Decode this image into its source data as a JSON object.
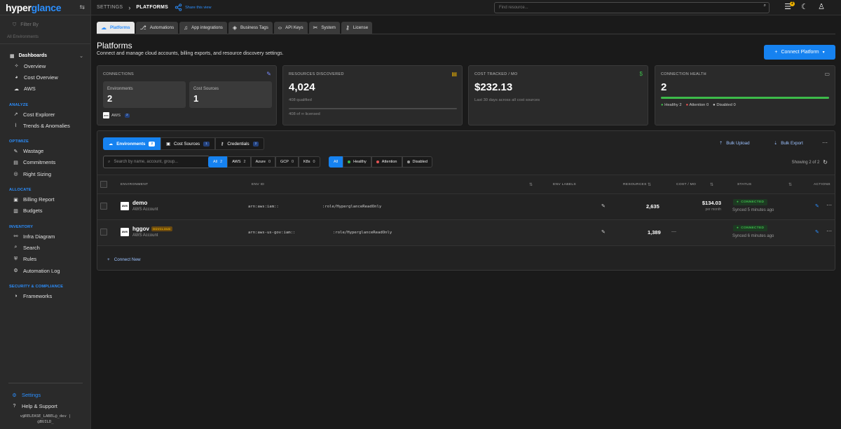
{
  "app": {
    "logo_a": "hyper",
    "logo_b": "glance"
  },
  "sidebar": {
    "filter_placeholder": "Filter By",
    "filter_scope": "All Environments",
    "dashboards": {
      "label": "Dashboards",
      "items": [
        {
          "label": "Overview",
          "icon": "sparkle-icon"
        },
        {
          "label": "Cost Overview",
          "icon": "pie-icon"
        },
        {
          "label": "AWS",
          "icon": "cloud-icon"
        }
      ]
    },
    "sections": [
      {
        "title": "ANALYZE",
        "items": [
          {
            "label": "Cost Explorer",
            "icon": "trend-icon"
          },
          {
            "label": "Trends & Anomalies",
            "icon": "chart-icon"
          }
        ]
      },
      {
        "title": "OPTIMIZE",
        "items": [
          {
            "label": "Wastage",
            "icon": "wrench-icon"
          },
          {
            "label": "Commitments",
            "icon": "calendar-icon"
          },
          {
            "label": "Right Sizing",
            "icon": "target-icon"
          }
        ]
      },
      {
        "title": "ALLOCATE",
        "items": [
          {
            "label": "Billing Report",
            "icon": "receipt-icon"
          },
          {
            "label": "Budgets",
            "icon": "wallet-icon"
          }
        ]
      },
      {
        "title": "INVENTORY",
        "items": [
          {
            "label": "Infra Diagram",
            "icon": "network-icon"
          },
          {
            "label": "Search",
            "icon": "search-icon"
          },
          {
            "label": "Rules",
            "icon": "shield-icon"
          },
          {
            "label": "Automation Log",
            "icon": "gear-icon"
          }
        ]
      },
      {
        "title": "SECURITY & COMPLIANCE",
        "items": [
          {
            "label": "Frameworks",
            "icon": "contrast-icon"
          }
        ]
      }
    ],
    "settings_label": "Settings",
    "help_label": "Help & Support",
    "version_line1": "v@RELEASE_LABEL@_dev |",
    "version_line2": "@BUILD_"
  },
  "topbar": {
    "crumb_root": "SETTINGS",
    "crumb_current": "PLATFORMS",
    "share_label": "Share this view",
    "search_placeholder": "Find resource...",
    "notif_count": "2"
  },
  "tabs": [
    {
      "label": "Platforms",
      "icon": "cloud-icon",
      "active": true
    },
    {
      "label": "Automations",
      "icon": "flow-icon"
    },
    {
      "label": "App integrations",
      "icon": "bell-icon"
    },
    {
      "label": "Business Tags",
      "icon": "tag-icon"
    },
    {
      "label": "API Keys",
      "icon": "code-icon"
    },
    {
      "label": "System",
      "icon": "wrench-icon"
    },
    {
      "label": "License",
      "icon": "key-icon"
    }
  ],
  "page": {
    "title": "Platforms",
    "subtitle": "Connect and manage cloud accounts, billing exports, and resource discovery settings.",
    "cta_label": "Connect Platform"
  },
  "cards": {
    "connections": {
      "title": "CONNECTIONS",
      "env_label": "Environments",
      "env_value": "2",
      "cost_label": "Cost Sources",
      "cost_value": "1",
      "chip_label": "AWS",
      "chip_count": "2"
    },
    "resources": {
      "title": "RESOURCES DISCOVERED",
      "value": "4,024",
      "note1": "408 qualified",
      "note2": "408 of ∞ licensed",
      "fill": 0
    },
    "cost": {
      "title": "COST TRACKED / MO",
      "value": "$232.13",
      "note": "Last 30 days across all cost sources"
    },
    "health": {
      "title": "CONNECTION HEALTH",
      "value": "2",
      "fill": 1.0,
      "healthy": "Healthy 2",
      "attention": "Attention 0",
      "disabled": "Disabled 0"
    }
  },
  "panel": {
    "subtabs": [
      {
        "label": "Environments",
        "count": "2",
        "icon": "cloud-icon",
        "active": true
      },
      {
        "label": "Cost Sources",
        "count": "1",
        "icon": "receipt-icon"
      },
      {
        "label": "Credentials",
        "count": "2",
        "icon": "key-icon"
      }
    ],
    "bulk_upload": "Bulk Upload",
    "bulk_export": "Bulk Export",
    "search_placeholder": "Search by name, account, group...",
    "provider_pills": [
      {
        "label": "All",
        "count": "2",
        "active": true
      },
      {
        "label": "AWS",
        "count": "2"
      },
      {
        "label": "Azure",
        "count": "0"
      },
      {
        "label": "GCP",
        "count": "0"
      },
      {
        "label": "K8s",
        "count": "0"
      }
    ],
    "status_pills": [
      {
        "label": "All",
        "active": true
      },
      {
        "label": "Healthy",
        "color": "#3dbb4a"
      },
      {
        "label": "Attention",
        "color": "#e55555"
      },
      {
        "label": "Disabled",
        "color": "#999999"
      }
    ],
    "showing": "Showing 2 of 2",
    "columns": {
      "environment": "ENVIRONMENT",
      "env_id": "ENV ID",
      "env_labels": "ENV LABELS",
      "resources": "RESOURCES",
      "cost": "COST / MO",
      "status": "STATUS",
      "actions": "ACTIONS"
    },
    "rows": [
      {
        "name": "demo",
        "sub": "AWS Account",
        "badge": "",
        "arn_a": "arn:aws:iam::",
        "arn_b": ":role/HyperglanceReadOnly",
        "resources": "2,635",
        "cost": "$134.03",
        "cost_sub": "per month",
        "status": "CONNECTED",
        "synced": "Synced 5 minutes ago"
      },
      {
        "name": "hggov",
        "sub": "AWS Account",
        "badge": "GOVCLOUD",
        "arn_a": "arn:aws-us-gov:iam::",
        "arn_b": ":role/HyperglanceReadOnly",
        "resources": "1,389",
        "cost": "—",
        "cost_sub": "",
        "status": "CONNECTED",
        "synced": "Synced 6 minutes ago"
      }
    ],
    "connect_new": "Connect New"
  }
}
